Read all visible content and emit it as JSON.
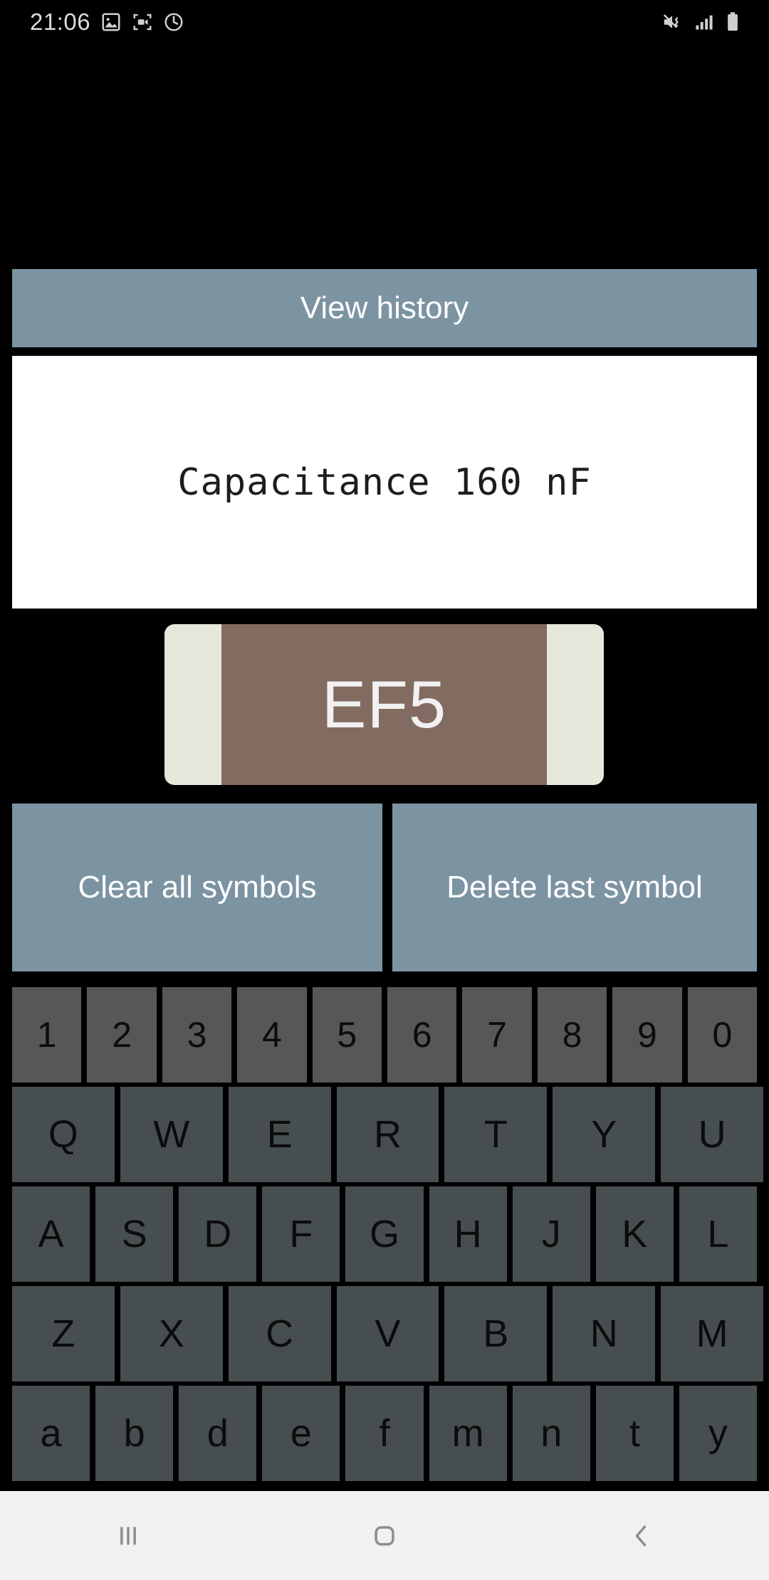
{
  "status_bar": {
    "time": "21:06",
    "left_icons": [
      "image-icon",
      "screen-record-icon",
      "rotation-icon"
    ],
    "right_icons": [
      "mute-vibrate-icon",
      "signal-bars-icon",
      "battery-icon"
    ]
  },
  "app": {
    "view_history_label": "View history",
    "readout": "Capacitance 160 nF",
    "component": {
      "code": "EF5",
      "body_color": "#826b60",
      "terminal_color": "#e5e8da",
      "label_color": "#f1f1f1"
    },
    "clear_label": "Clear all symbols",
    "delete_label": "Delete last symbol",
    "accent_color": "#7c94a2"
  },
  "keyboard": {
    "rows": [
      {
        "type": "num",
        "keys": [
          "1",
          "2",
          "3",
          "4",
          "5",
          "6",
          "7",
          "8",
          "9",
          "0"
        ]
      },
      {
        "type": "alpha",
        "keys": [
          "Q",
          "W",
          "E",
          "R",
          "T",
          "Y",
          "U"
        ]
      },
      {
        "type": "alpha",
        "keys": [
          "A",
          "S",
          "D",
          "F",
          "G",
          "H",
          "J",
          "K",
          "L"
        ]
      },
      {
        "type": "alpha",
        "keys": [
          "Z",
          "X",
          "C",
          "V",
          "B",
          "N",
          "M"
        ]
      },
      {
        "type": "lower",
        "keys": [
          "a",
          "b",
          "d",
          "e",
          "f",
          "m",
          "n",
          "t",
          "y"
        ]
      }
    ],
    "num_key_color": "#575757",
    "alpha_key_color": "#464e50"
  },
  "nav_bar": {
    "recents_label": "recents-icon",
    "home_label": "home-icon",
    "back_label": "back-icon"
  }
}
